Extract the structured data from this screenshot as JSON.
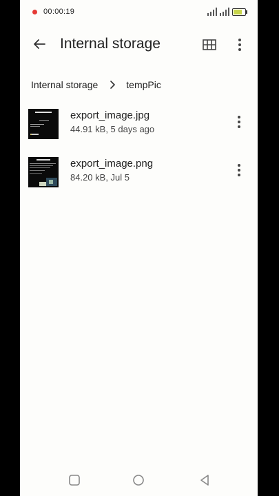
{
  "status_bar": {
    "time": "00:00:19",
    "icons": [
      "record-dot-icon",
      "signal-icon",
      "signal-icon",
      "battery-charging-icon"
    ]
  },
  "toolbar": {
    "back_icon": "arrow-left-icon",
    "title": "Internal storage",
    "grid_icon": "grid-view-icon",
    "more_icon": "more-vert-icon"
  },
  "breadcrumb": {
    "items": [
      "Internal storage",
      "tempPic"
    ],
    "separator_icon": "chevron-right-icon"
  },
  "files": [
    {
      "name": "export_image.jpg",
      "meta": "44.91 kB, 5 days ago",
      "more_icon": "more-vert-icon"
    },
    {
      "name": "export_image.png",
      "meta": "84.20 kB, Jul 5",
      "more_icon": "more-vert-icon"
    }
  ],
  "nav_bar": {
    "icons": [
      "recents-square-icon",
      "home-circle-icon",
      "back-triangle-icon"
    ]
  },
  "colors": {
    "background": "#fdfdfb",
    "text": "#222222",
    "recording": "#e53935",
    "battery_fill": "#c6d44a"
  }
}
